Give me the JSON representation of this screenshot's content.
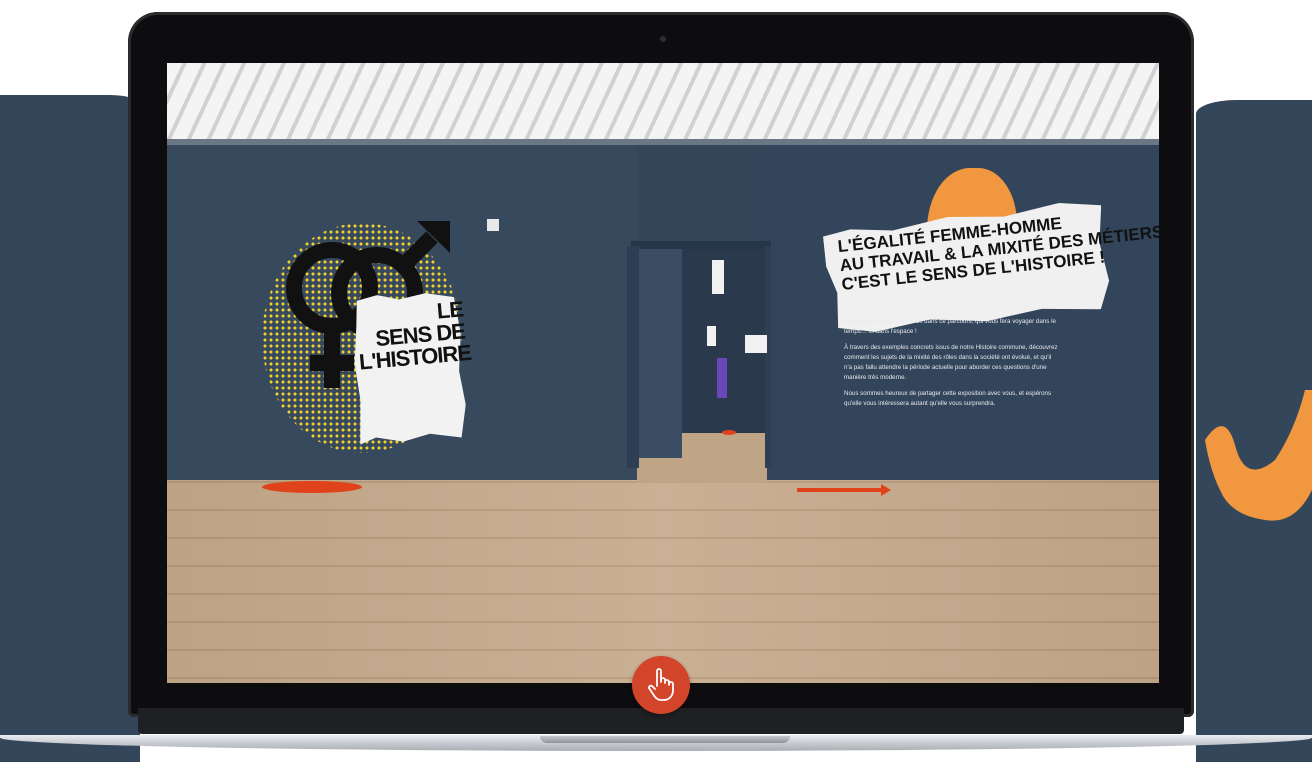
{
  "left_panel": {
    "title": "LE\nSENS DE\nL'HISTOIRE"
  },
  "right_panel": {
    "title_lines": [
      "L'ÉGALITÉ FEMME-HOMME",
      "AU TRAVAIL & LA MIXITÉ DES MÉTIERS,",
      "C'EST LE SENS DE L'HISTOIRE !"
    ],
    "paragraphs": [
      "Bienvenue à toutes et à tous dans ce parcours, qui vous fera voyager dans le temps… et dans l'espace !",
      "À travers des exemples concrets issus de notre Histoire commune, découvrez comment les sujets de la mixité des rôles dans la société ont évolué, et qu'il n'a pas fallu attendre la période actuelle pour aborder ces questions d'une manière très moderne.",
      "Nous sommes heureux de partager cette exposition avec vous, et espérons qu'elle vous intéressera autant qu'elle vous surprendra."
    ]
  },
  "icons": {
    "interact": "pointing-hand-icon",
    "gender": "female-male-symbols-icon"
  },
  "colors": {
    "background_navy": "#34475a",
    "accent_orange": "#f0973f",
    "marker_red": "#e0421c",
    "button_red": "#d2452b",
    "halftone_yellow": "#f3d12b"
  }
}
